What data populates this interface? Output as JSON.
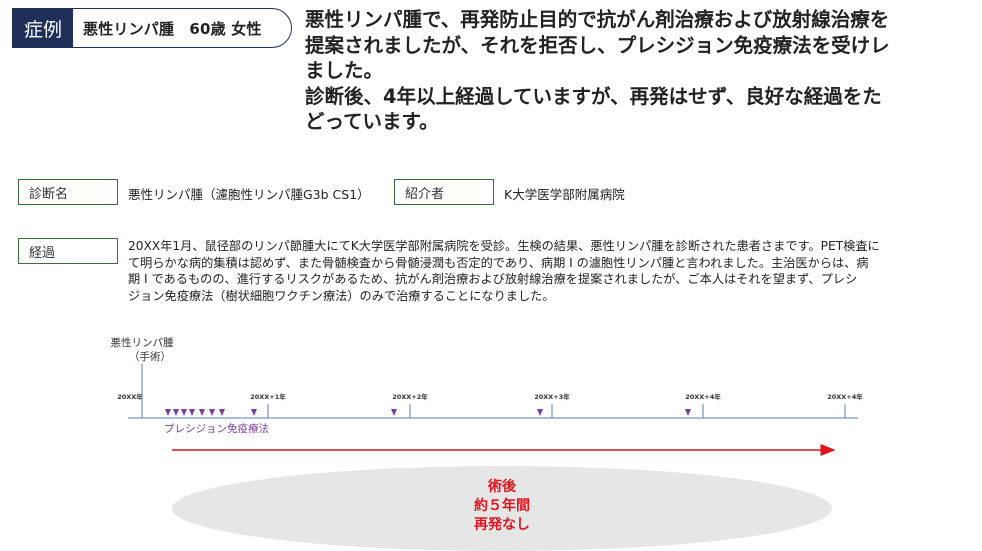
{
  "header": {
    "tag": "症例",
    "title": "悪性リンパ腫　60歳 女性"
  },
  "headline": [
    "悪性リンパ腫で、再発防止目的で抗がん剤治療および放射線治療を",
    "提案されましたが、それを拒否し、プレシジョン免疫療法を受けレ",
    "ました。",
    "診断後、4年以上経過していますが、再発はせず、良好な経過をた",
    "どっています。"
  ],
  "diagnosis": {
    "label": "診断名",
    "value": "悪性リンパ腫（濾胞性リンパ腫G3b CS1）"
  },
  "referrer": {
    "label": "紹介者",
    "value": "K大学医学部附属病院"
  },
  "course": {
    "label": "経過",
    "lines": [
      "20XX年1月、鼠径部のリンパ節腫大にてK大学医学部附属病院を受診。生検の結果、悪性リンパ腫を診断された患者さまです。PET検査に",
      "て明らかな病的集積は認めず、また骨髄検査から骨髄浸潤も否定的であり、病期 I の濾胞性リンパ腫と言われました。主治医からは、病",
      "期 I であるものの、進行するリスクがあるため、抗がん剤治療および放射線治療を提案されましたが、ご本人はそれを望まず、プレシ",
      "ジョン免疫療法（樹状細胞ワクチン療法）のみで治療することになりました。"
    ]
  },
  "timeline": {
    "event_label": "悪性リンパ腫",
    "event_sub": "（手術）",
    "years": [
      "20XX年",
      "20XX+1年",
      "20XX+2年",
      "20XX+3年",
      "20XX+4年",
      "20XX+4年"
    ],
    "therapy_label": "プレシジョン免疫療法",
    "marker_color": "#7a3e9d",
    "arrow_color": "#e0141e"
  },
  "result": {
    "lines": [
      "術後",
      "約５年間",
      "再発なし"
    ]
  }
}
